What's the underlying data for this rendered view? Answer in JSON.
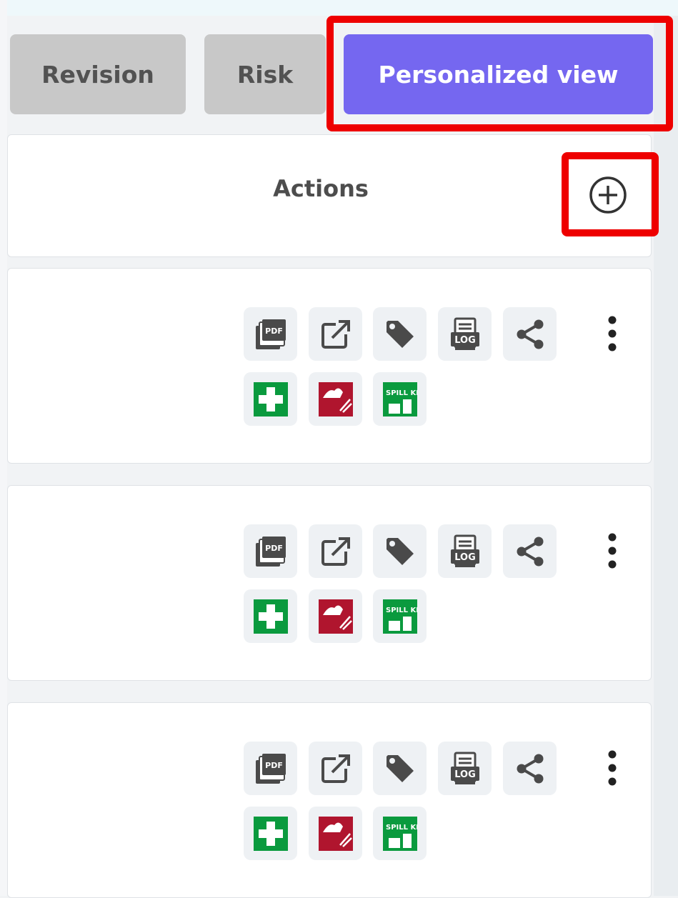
{
  "tabs": [
    {
      "label": "Revision",
      "active": false
    },
    {
      "label": "Risk",
      "active": false
    },
    {
      "label": "Personalized view",
      "active": true
    }
  ],
  "header": {
    "actions_label": "Actions",
    "add_icon": "plus-circle-icon"
  },
  "icon_labels": {
    "pdf": "PDF",
    "log": "LOG",
    "spill_kit": "SPILL KIT"
  },
  "row_icons": [
    "pdf-icon",
    "external-link-icon",
    "tag-icon",
    "log-icon",
    "share-icon",
    "first-aid-icon",
    "flame-red-icon",
    "spill-kit-icon",
    "more-vertical-icon"
  ],
  "colors": {
    "active_tab": "#7567f0",
    "inactive_tab": "#c8c8c8",
    "highlight": "#ee0000",
    "first_aid_green": "#0a9a3e",
    "hazard_red": "#b0152e",
    "icon_gray": "#4a4a4a"
  }
}
